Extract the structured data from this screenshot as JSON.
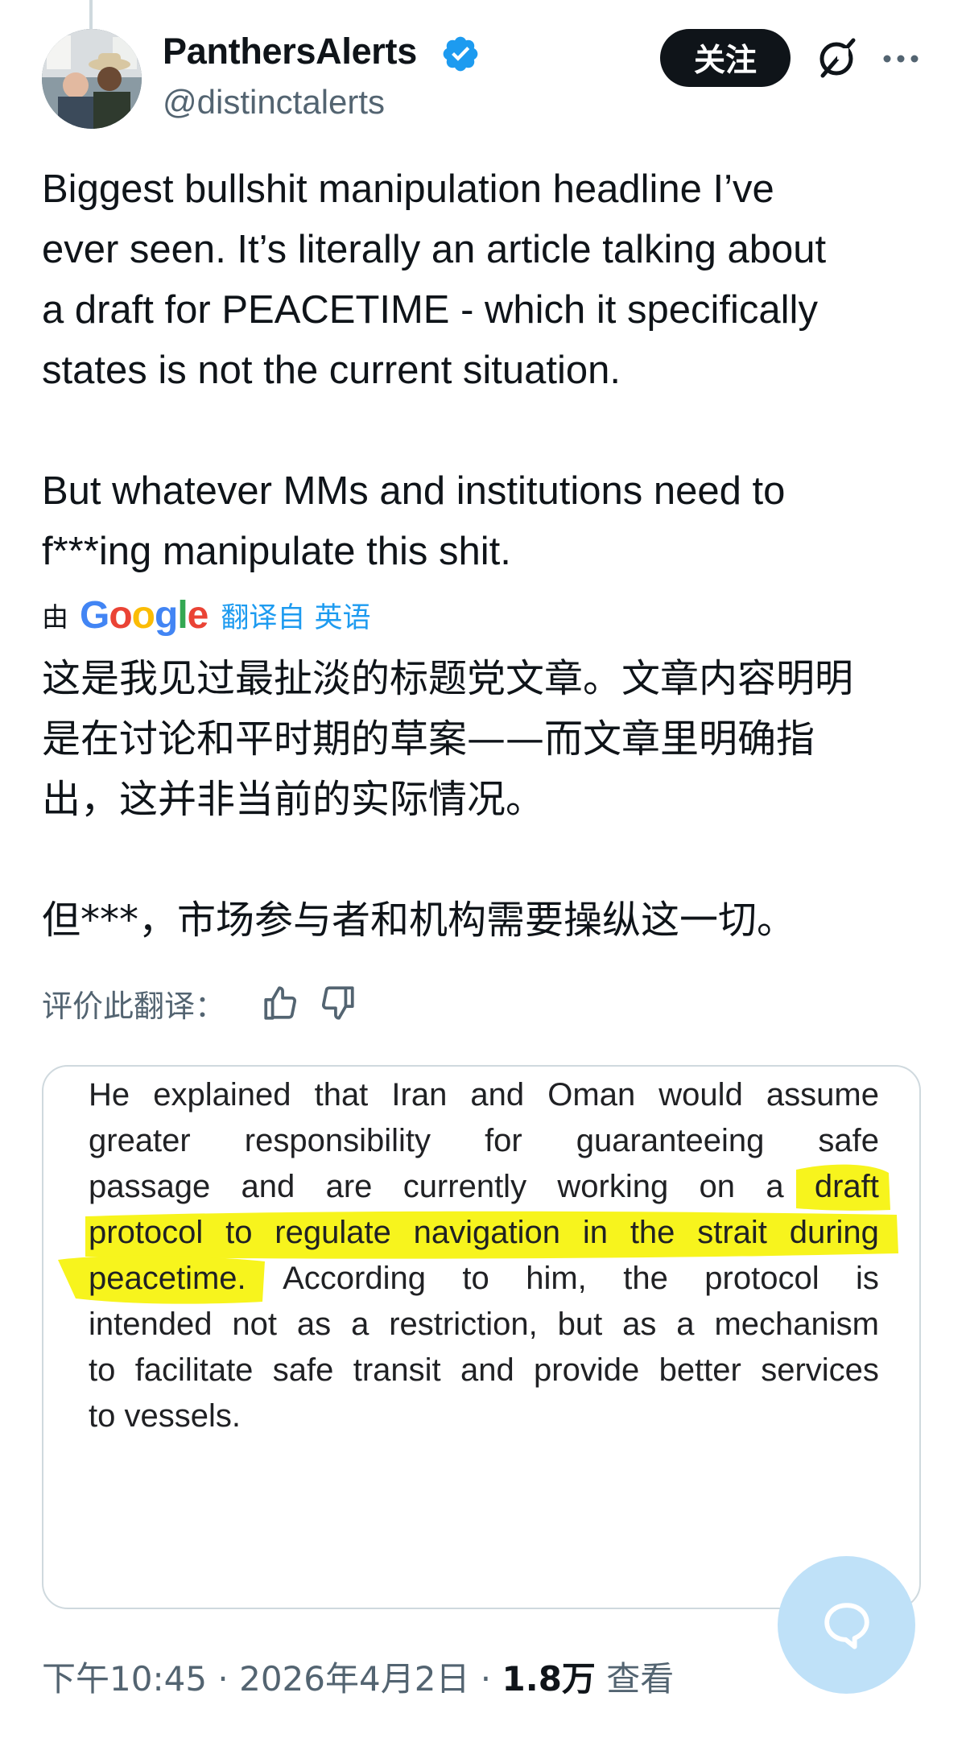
{
  "author": {
    "display_name": "PanthersAlerts",
    "handle": "@distinctalerts",
    "verified": true,
    "avatar_icon": "user-avatar-photo"
  },
  "header": {
    "follow_label": "关注",
    "grok_icon": "grok-icon",
    "more_icon": "more-horizontal-icon"
  },
  "tweet": {
    "text": "Biggest bullshit manipulation headline I’ve\never seen. It’s literally an article talking about\na draft for PEACETIME - which it specifically\nstates is not the current situation.\n\nBut whatever MMs and institutions need to\nf***ing manipulate this shit.",
    "translate": {
      "by_label": "由",
      "google_letters": [
        "G",
        "o",
        "o",
        "g",
        "l",
        "e"
      ],
      "link_label": "翻译自 英语"
    },
    "translated_text": "这是我见过最扯淡的标题党文章。文章内容明明\n是在讨论和平时期的草案——而文章里明确指\n出，这并非当前的实际情况。\n\n但***，市场参与者和机构需要操纵这一切。",
    "rate_label": "评价此翻译："
  },
  "quoted_image": {
    "lines": [
      "He explained that Iran and Oman would assume",
      "greater responsibility for guaranteeing safe",
      "passage and are currently working on a draft",
      "protocol to regulate navigation in the strait during",
      "peacetime. According to him, the protocol is",
      "intended not as a restriction, but as a mechanism",
      "to facilitate safe transit and provide better services",
      "to vessels."
    ],
    "highlight_color": "#f7f41d"
  },
  "meta": {
    "time": "下午10:45",
    "separator": " · ",
    "date": "2026年4月2日",
    "views_count": "1.8万",
    "views_label": "查看"
  },
  "colors": {
    "accent": "#1d9bf0",
    "text_primary": "#0f1419",
    "text_secondary": "#536471",
    "follow_bg": "#0f1419",
    "chat_fab_bg": "#bfe1f8"
  }
}
